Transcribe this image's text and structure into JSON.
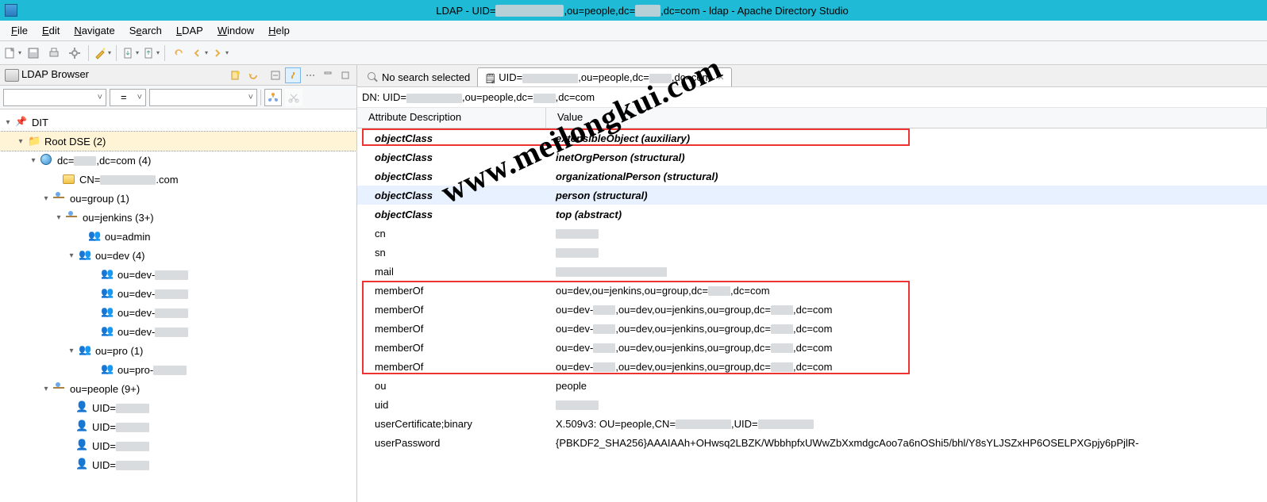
{
  "title_prefix": "LDAP - UID=",
  "title_mid1": ",ou=people,dc=",
  "title_mid2": ",dc=com - ldap - Apache Directory Studio",
  "menu": [
    "File",
    "Edit",
    "Navigate",
    "Search",
    "LDAP",
    "Window",
    "Help"
  ],
  "menu_ul": [
    "F",
    "E",
    "N",
    "e",
    "L",
    "W",
    "H"
  ],
  "left_panel_title": "LDAP Browser",
  "filter_op": "=",
  "tree": {
    "root": "DIT",
    "root_dse": "Root DSE (2)",
    "dc_prefix": "dc=",
    "dc_suffix": ",dc=com (4)",
    "cn_prefix": "CN=",
    "cn_suffix": ".com",
    "group": "ou=group (1)",
    "jenkins": "ou=jenkins (3+)",
    "admin": "ou=admin",
    "dev": "ou=dev (4)",
    "dev_children": [
      "ou=dev-",
      "ou=dev-",
      "ou=dev-",
      "ou=dev-"
    ],
    "pro": "ou=pro (1)",
    "pro_child": "ou=pro-",
    "people": "ou=people (9+)",
    "uids": [
      "UID=",
      "UID=",
      "UID=",
      "UID="
    ]
  },
  "tabs": {
    "search": "No search selected",
    "entry_prefix": "UID=",
    "entry_mid1": ",ou=people,dc=",
    "entry_mid2": ",dc=com"
  },
  "dn_prefix": "DN: UID=",
  "dn_mid1": ",ou=people,dc=",
  "dn_mid2": ",dc=com",
  "cols": {
    "attr": "Attribute Description",
    "val": "Value"
  },
  "rows": [
    {
      "attr": "objectClass",
      "val": "extensibleObject (auxiliary)",
      "oc": true,
      "red1": true
    },
    {
      "attr": "objectClass",
      "val": "inetOrgPerson (structural)",
      "oc": true
    },
    {
      "attr": "objectClass",
      "val": "organizationalPerson (structural)",
      "oc": true
    },
    {
      "attr": "objectClass",
      "val": "person (structural)",
      "oc": true,
      "sel": true
    },
    {
      "attr": "objectClass",
      "val": "top (abstract)",
      "oc": true
    },
    {
      "attr": "cn",
      "val": "[blur]"
    },
    {
      "attr": "sn",
      "val": "[blur]"
    },
    {
      "attr": "mail",
      "val": "[blur-long]"
    },
    {
      "attr": "memberOf",
      "val": "ou=dev,ou=jenkins,ou=group,dc=[b],dc=com",
      "red2": true
    },
    {
      "attr": "memberOf",
      "val": "ou=dev-[b],ou=dev,ou=jenkins,ou=group,dc=[b],dc=com",
      "red2": true
    },
    {
      "attr": "memberOf",
      "val": "ou=dev-[b],ou=dev,ou=jenkins,ou=group,dc=[b],dc=com",
      "red2": true
    },
    {
      "attr": "memberOf",
      "val": "ou=dev-[b],ou=dev,ou=jenkins,ou=group,dc=[b],dc=com",
      "red2": true
    },
    {
      "attr": "memberOf",
      "val": "ou=dev-[b],ou=dev,ou=jenkins,ou=group,dc=[b],dc=com",
      "red2": true
    },
    {
      "attr": "ou",
      "val": "people"
    },
    {
      "attr": "uid",
      "val": "[blur]"
    },
    {
      "attr": "userCertificate;binary",
      "val": "X.509v3: OU=people,CN=[blur-w2],UID=[blur-w2]"
    },
    {
      "attr": "userPassword",
      "val": "{PBKDF2_SHA256}AAAIAAh+OHwsq2LBZK/WbbhpfxUWwZbXxmdgcAoo7a6nOShi5/bhl/Y8sYLJSZxHP6OSELPXGpjy6pPjlR-"
    }
  ],
  "watermark": "www.meilongkui.com"
}
